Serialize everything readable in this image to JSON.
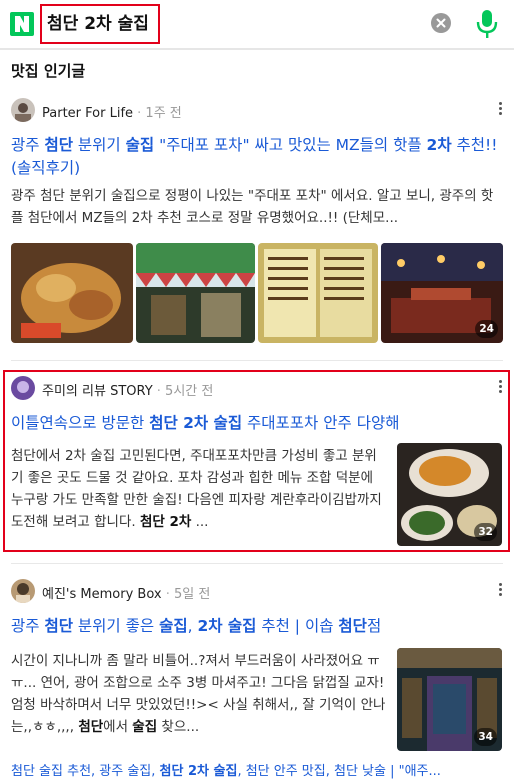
{
  "search": {
    "query": "첨단 2차 술집",
    "brand_color": "#03c75a",
    "highlight_color": "#e2001a"
  },
  "section": {
    "title": "맛집 인기글"
  },
  "posts": [
    {
      "author": "Parter For Life",
      "sep": " · ",
      "time": "1주 전",
      "title_parts": [
        "광주 ",
        "첨단",
        " 분위기 ",
        "술집",
        " \"주대포 포차\" 싸고 맛있는 MZ들의 핫플 ",
        "2차",
        " 추천!! (솔직후기)"
      ],
      "snippet": "광주 첨단 분위기 술집으로 정평이 나있는 \"주대포 포차\" 에서요. 알고 보니, 광주의 핫플 첨단에서 MZ들의 2차 추천 코스로 정말 유명했어요..!! (단체모...",
      "photo_count": "24"
    },
    {
      "author": "주미의 리뷰 STORY",
      "sep": " · ",
      "time": "5시간 전",
      "title_parts": [
        "이틀연속으로 방문한 ",
        "첨단 2차 술집",
        " 주대포포차 안주 다양해"
      ],
      "snippet_parts": [
        "첨단에서 2차 술집 고민된다면, 주대포포차만큼 가성비 좋고 분위기 좋은 곳도 드물 것 같아요. 포차 감성과 힙한 메뉴 조합 덕분에 누구랑 가도 만족할 만한 술집! 다음엔 피자랑 계란후라이김밥까지 도전해 보려고 합니다. ",
        "첨단 2차",
        " ..."
      ],
      "photo_count": "32"
    },
    {
      "author": "예진's Memory Box",
      "sep": " · ",
      "time": "5일 전",
      "title_parts": [
        "광주 ",
        "첨단",
        " 분위기 좋은 ",
        "술집",
        ", ",
        "2차 술집",
        " 추천 | 이솝 ",
        "첨단",
        "점"
      ],
      "snippet_parts": [
        "시간이 지나니까 좀 말라 비틀어..?져서 부드러움이 사라졌어요 ㅠㅠ... 연어, 광어 조합으로 소주 3병 마셔주고! 그다음 닭껍질 교자! 엄청 바삭하며서 너무 맛있었던!!>< 사실 취해서,, 잘 기억이 안나는,,ㅎㅎ,,,, ",
        "첨단",
        "에서 ",
        "술집",
        " 찾으..."
      ],
      "photo_count": "34"
    }
  ],
  "tags": {
    "parts": [
      "첨단 술집 추천, 광주 술집, ",
      "첨단 2차 술집",
      ", 첨단 안주 맛집, 첨단 낮술 | \"애주..."
    ]
  }
}
